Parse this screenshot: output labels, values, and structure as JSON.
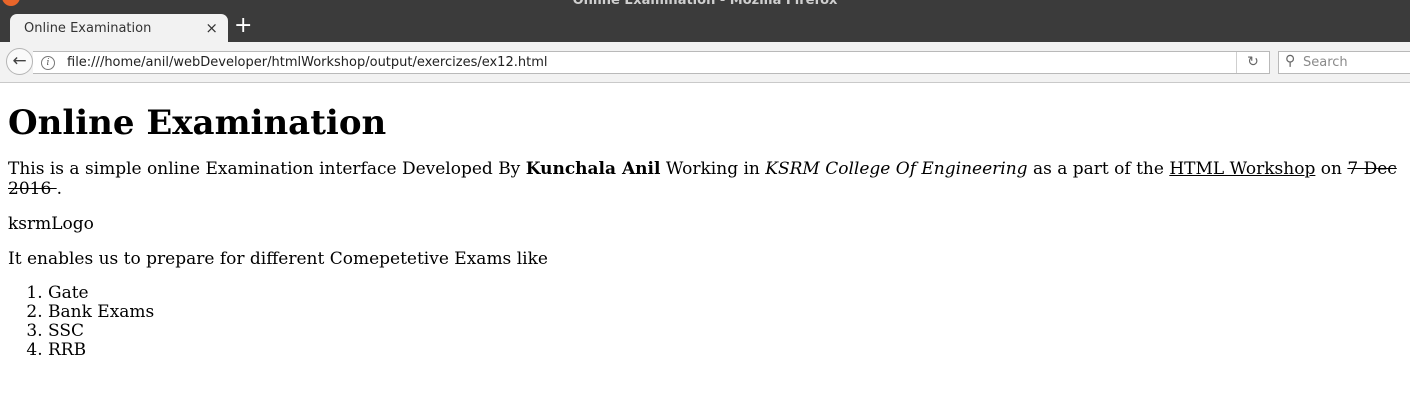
{
  "browser": {
    "window_title": "Online Examination - Mozilla Firefox",
    "tab_title": "Online Examination",
    "tab_close": "×",
    "new_tab": "+",
    "url": "file:///home/anil/webDeveloper/htmlWorkshop/output/exercizes/ex12.html",
    "search_placeholder": "Search"
  },
  "page": {
    "heading": "Online Examination",
    "intro": {
      "prefix": "This is a simple online Examination interface Developed By ",
      "author": "Kunchala Anil",
      "working_in": " Working in ",
      "college": "KSRM College Of Engineering",
      "part_of": " as a part of the ",
      "workshop_link": "HTML Workshop",
      "on": " on ",
      "date": "7 Dec 2016 ",
      "period": "."
    },
    "logo_alt": "ksrmLogo",
    "exams_intro": "It enables us to prepare for different Comepetetive Exams like",
    "exams": [
      "Gate",
      "Bank Exams",
      "SSC",
      "RRB"
    ]
  }
}
